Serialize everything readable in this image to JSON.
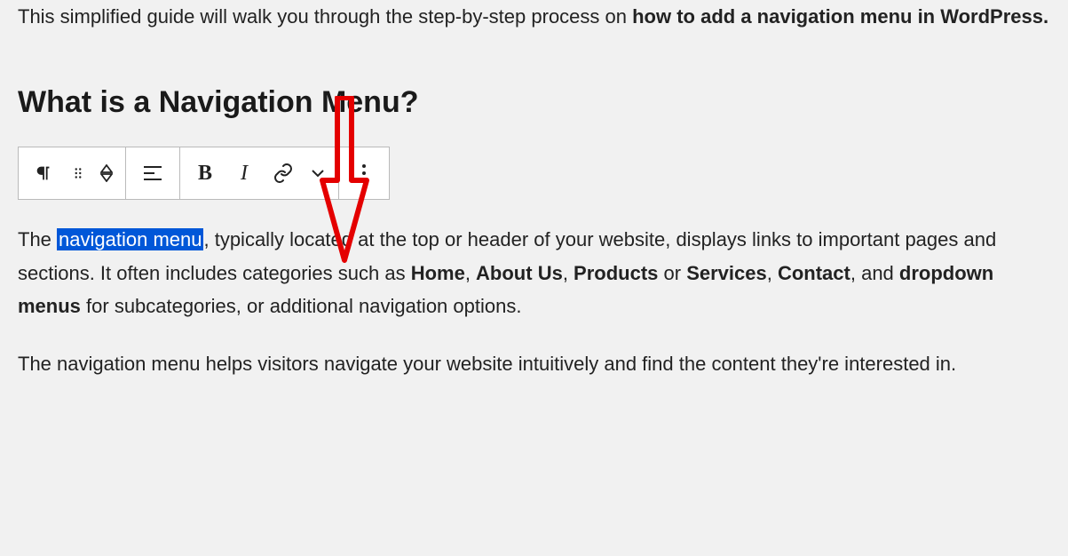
{
  "intro": {
    "prefix": "This simplified guide will walk you through the step-by-step process on ",
    "bold": "how to add a navigation menu in WordPress.",
    "suffix": ""
  },
  "heading": "What is a Navigation Menu?",
  "toolbar": {
    "bold_label": "B",
    "italic_label": "I"
  },
  "para1": {
    "t1": "The ",
    "highlight": "navigation menu",
    "t2": ", typically located at the top or header of your website, displays links to important pages and sections. It often includes categories such as ",
    "b1": "Home",
    "c1": ", ",
    "b2": "About Us",
    "c2": ", ",
    "b3": "Products",
    "c3": " or ",
    "b4": "Services",
    "c4": ", ",
    "b5": "Contact",
    "c5": ", and ",
    "b6": "dropdown menus",
    "t3": " for subcategories, or additional navigation options."
  },
  "para2": "The navigation menu helps visitors navigate your website intuitively and find the content they're interested in."
}
